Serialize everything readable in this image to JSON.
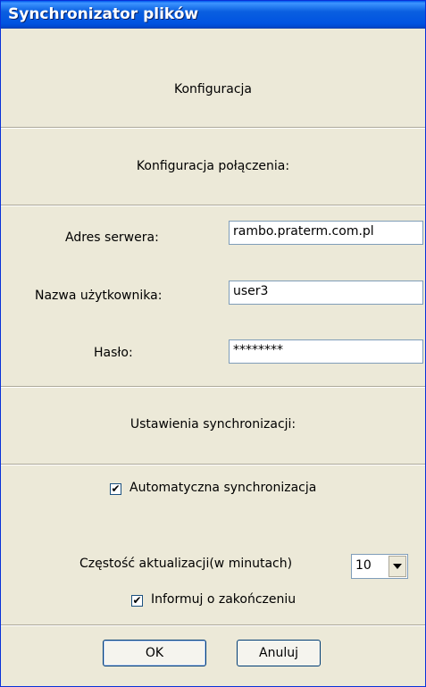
{
  "window": {
    "title": "Synchronizator plików"
  },
  "config_heading": "Konfiguracja",
  "connection": {
    "heading": "Konfiguracja połączenia:",
    "server_label": "Adres serwera:",
    "server_value": "rambo.praterm.com.pl",
    "user_label": "Nazwa użytkownika:",
    "user_value": "user3",
    "password_label": "Hasło:",
    "password_value": "********"
  },
  "sync": {
    "heading": "Ustawienia synchronizacji:",
    "auto_label": "Automatyczna synchronizacja",
    "auto_checked": true,
    "frequency_label": "Częstość aktualizacji(w minutach)",
    "frequency_value": "10",
    "notify_label": "Informuj o zakończeniu",
    "notify_checked": true
  },
  "buttons": {
    "ok": "OK",
    "cancel": "Anuluj"
  },
  "colors": {
    "titlebar": "#0053e1",
    "dialog_bg": "#ece9d8",
    "input_border": "#7f9db9"
  }
}
